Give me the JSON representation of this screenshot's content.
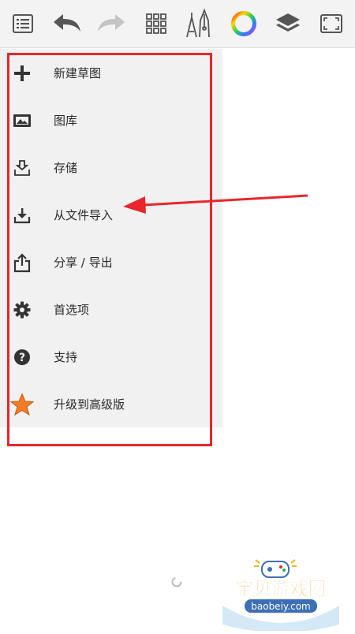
{
  "toolbar": {
    "icons": [
      "list-icon",
      "undo-icon",
      "redo-icon",
      "grid-icon",
      "brushes-icon",
      "color-wheel-icon",
      "layers-icon",
      "fullscreen-icon"
    ]
  },
  "menu": {
    "items": [
      {
        "label": "新建草图",
        "icon": "plus-icon"
      },
      {
        "label": "图库",
        "icon": "gallery-icon"
      },
      {
        "label": "存储",
        "icon": "save-icon"
      },
      {
        "label": "从文件导入",
        "icon": "import-icon"
      },
      {
        "label": "分享 / 导出",
        "icon": "share-icon"
      },
      {
        "label": "首选项",
        "icon": "gear-icon"
      },
      {
        "label": "支持",
        "icon": "help-icon"
      },
      {
        "label": "升级到高级版",
        "icon": "star-icon"
      }
    ]
  },
  "annotation": {
    "color": "#e8262b"
  },
  "watermark": {
    "brand": "宝贝游戏网",
    "url": "baobeiy.com"
  },
  "colors": {
    "toolbar_bg": "#f3f3f3",
    "menu_bg": "#f1f1f1",
    "star": "#f07c27",
    "icon": "#333333"
  }
}
